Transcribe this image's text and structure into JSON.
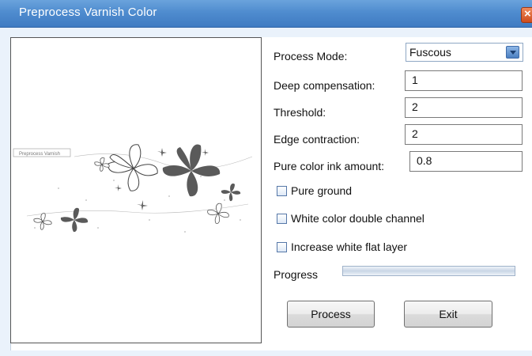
{
  "window": {
    "title": "Preprocess Varnish Color",
    "close_glyph": "×"
  },
  "preview": {
    "tiny_caption": "Preprocess Varnish"
  },
  "form": {
    "process_mode_label": "Process Mode:",
    "process_mode_value": "Fuscous",
    "deep_compensation_label": "Deep compensation:",
    "deep_compensation_value": "1",
    "threshold_label": "Threshold:",
    "threshold_value": "2",
    "edge_contraction_label": "Edge contraction:",
    "edge_contraction_value": "2",
    "pure_color_ink_label": "Pure color ink amount:",
    "pure_color_ink_value": "0.8",
    "pure_ground_label": "Pure ground",
    "pure_ground_checked": false,
    "white_double_label": "White color double channel",
    "white_double_checked": false,
    "increase_white_label": "Increase white flat layer",
    "increase_white_checked": false,
    "progress_label": "Progress",
    "progress_value": 0
  },
  "buttons": {
    "process": "Process",
    "exit": "Exit"
  },
  "colors": {
    "title_bar": "#4f8ccf",
    "client_bg": "#eaf2fb",
    "flower_dark": "#555555"
  }
}
